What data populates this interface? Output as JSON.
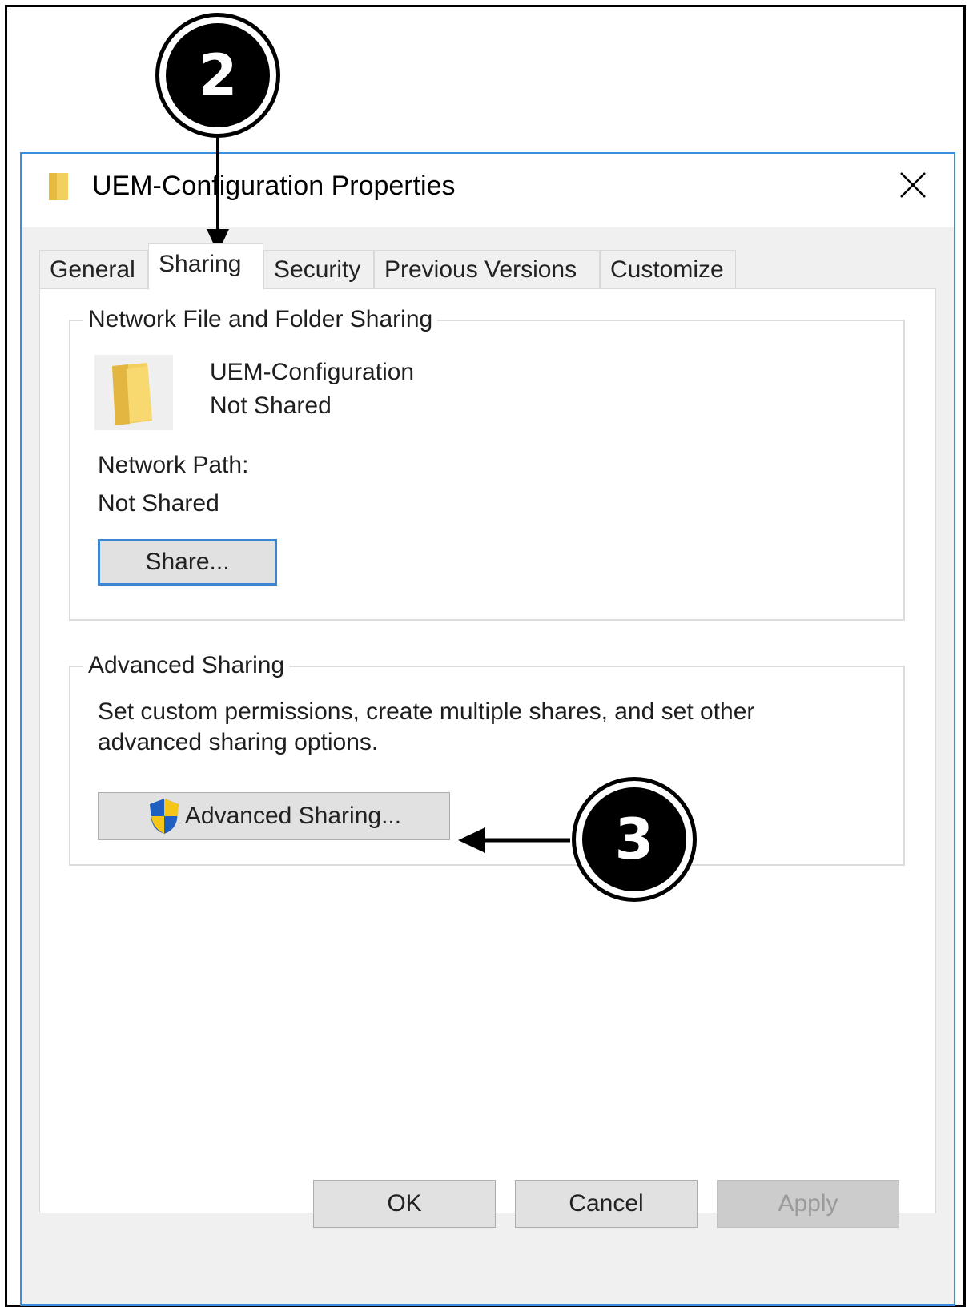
{
  "window": {
    "title": "UEM-Configuration Properties"
  },
  "tabs": [
    {
      "label": "General"
    },
    {
      "label": "Sharing"
    },
    {
      "label": "Security"
    },
    {
      "label": "Previous Versions"
    },
    {
      "label": "Customize"
    }
  ],
  "network_sharing": {
    "legend": "Network File and Folder Sharing",
    "folder_name": "UEM-Configuration",
    "status": "Not Shared",
    "path_label": "Network Path:",
    "path_value": "Not Shared",
    "share_button": "Share..."
  },
  "advanced_sharing": {
    "legend": "Advanced Sharing",
    "description_line1": "Set custom permissions, create multiple shares, and set other",
    "description_line2": "advanced sharing options.",
    "button": "Advanced Sharing..."
  },
  "buttons": {
    "ok": "OK",
    "cancel": "Cancel",
    "apply": "Apply"
  },
  "callouts": {
    "step2": "2",
    "step3": "3"
  },
  "colors": {
    "accent": "#3b8ede",
    "folder": "#f3cf5f",
    "shield_blue": "#1f5fbf",
    "shield_yellow": "#f5c518"
  }
}
